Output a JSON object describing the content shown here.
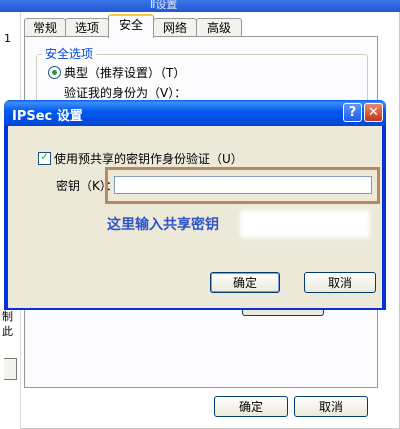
{
  "background_window": {
    "title": "Ⅱ设置",
    "left_label": "1",
    "tabs": [
      "常规",
      "选项",
      "安全",
      "网络",
      "高级"
    ],
    "active_tab": "安全",
    "group_label": "安全选项",
    "radio_label": "典型（推荐设置）（T）",
    "verify_label": "验证我的身份为（V）：",
    "left_fragments": [
      "制",
      "此"
    ],
    "ok_label": "确定",
    "cancel_label": "取消"
  },
  "ipsec_dialog": {
    "title": "IPSec 设置",
    "help_label": "?",
    "close_label": "✕",
    "checkbox_label": "使用预共享的密钥作身份验证（U）",
    "checkbox_checked": true,
    "key_label": "密钥（K）：",
    "key_value": "",
    "annotation": "这里输入共享密钥",
    "ok_label": "确定",
    "cancel_label": "取消"
  },
  "colors": {
    "title_blue": "#0058ee",
    "annotation_blue": "#2f54c8",
    "highlight_frame": "#b58a5c",
    "dialog_face": "#ece9d8"
  }
}
